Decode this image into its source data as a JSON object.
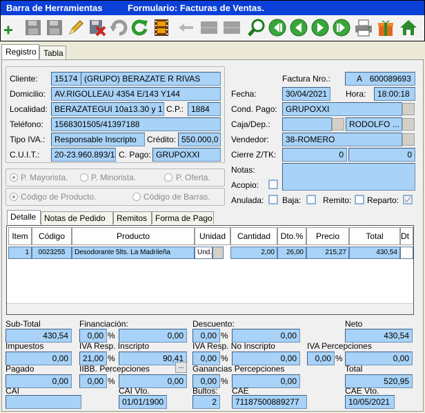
{
  "window": {
    "app_title": "Barra de Herramientas",
    "form_title": "Formulario: Facturas de Ventas."
  },
  "toolbar": {
    "buttons": [
      "add-icon",
      "save-icon",
      "save-disabled-icon",
      "edit-icon",
      "delete-icon",
      "undo-icon",
      "refresh-icon",
      "film-icon",
      "back-icon",
      "disabled-icon",
      "disabled-icon",
      "search-icon",
      "first-icon",
      "previous-icon",
      "next-icon",
      "last-icon",
      "print-icon",
      "gift-icon",
      "home-icon"
    ]
  },
  "tabs": {
    "registro": "Registro",
    "tabla": "Tabla"
  },
  "cliente": {
    "cliente_label": "Cliente:",
    "cliente_code": "15174",
    "cliente_name": "(GRUPO) BERAZATE R RIVAS",
    "domicilio_label": "Domicilio:",
    "domicilio": "AV.RIGOLLEAU 4354 E/143 Y144",
    "localidad_label": "Localidad:",
    "localidad": "BERAZATEGUI 10a13.30 y 1",
    "cp_label": "C.P.:",
    "cp": "1884",
    "telefono_label": "Teléfono:",
    "telefono": "1568301505/41397188",
    "tipo_iva_label": "Tipo IVA.:",
    "tipo_iva": "Responsable Inscripto",
    "credito_label": "Crédito:",
    "credito": "550.000,0",
    "cuit_label": "C.U.I.T.:",
    "cuit": "20-23.960.893/1",
    "cpago_label": "C. Pago:",
    "cpago": "GRUPOXXI"
  },
  "factura": {
    "nro_label": "Factura Nro.:",
    "nro_letter": "A",
    "nro": "600089693",
    "fecha_label": "Fecha:",
    "fecha": "30/04/2021",
    "hora_label": "Hora:",
    "hora": "18:00:18",
    "cond_pago_label": "Cond. Pago:",
    "cond_pago": "GRUPOXXI",
    "caja_label": "Caja/Dep.:",
    "caja": "",
    "deposito": "RODOLFO ...",
    "vendedor_label": "Vendedor:",
    "vendedor": "38-ROMERO",
    "cierre_label": "Cierre Z/TK:",
    "cierre1": "0",
    "cierre2": "0",
    "notas_label": "Notas:",
    "acopio_label": "Acopio:",
    "anulada_label": "Anulada:",
    "baja_label": "Baja:",
    "remito_label": "Remito:",
    "reparto_label": "Reparto:"
  },
  "precio_opts": {
    "mayorista": "P. Mayorista.",
    "minorista": "P. Minorista.",
    "oferta": "P. Oferta."
  },
  "codigo_opts": {
    "producto": "Código de Producto.",
    "barras": "Código de Barras."
  },
  "subtabs": [
    "Detalle",
    "Notas de Pedido",
    "Remitos",
    "Forma de Pago"
  ],
  "grid": {
    "headers": [
      "Item",
      "Código",
      "Producto",
      "Unidad",
      "Cantidad",
      "Dto.%",
      "Precio",
      "Total",
      "Dt"
    ],
    "rows": [
      {
        "item": "1",
        "codigo": "0023255",
        "producto": "Desodorante 5lts. La Madrileña",
        "unidad": "Und.",
        "cantidad": "2,00",
        "dto": "26,00",
        "precio": "215,27",
        "total": "430,54"
      }
    ]
  },
  "totales": {
    "subtotal_label": "Sub-Total",
    "subtotal": "430,54",
    "financiacion_label": "Financiación:",
    "financiacion_pct": "0,00",
    "financiacion": "0,00",
    "descuento_label": "Descuento:",
    "descuento_pct": "0,00",
    "descuento": "0,00",
    "neto_label": "Neto",
    "neto": "430,54",
    "impuestos_label": "Impuestos",
    "impuestos": "0,00",
    "iva_ri_label": "IVA Resp. Inscripto",
    "iva_ri_pct": "21,00",
    "iva_ri": "90,41",
    "iva_rni_label": "IVA Resp. No Inscripto",
    "iva_rni_pct": "0,00",
    "iva_rni": "0,00",
    "iva_perc_label": "IVA Percepciones",
    "iva_perc_pct": "0,00",
    "iva_perc": "0,00",
    "pagado_label": "Pagado",
    "pagado": "0,00",
    "iibb_label": "IIBB. Percepciones",
    "iibb_pct": "0,00",
    "iibb": "0,00",
    "iibb_btn": "...",
    "ganancias_label": "Ganancias Percepciones",
    "ganancias_pct": "0,00",
    "ganancias": "0,00",
    "total_label": "Total",
    "total": "520,95",
    "cai_label": "CAI",
    "cai": "",
    "cai_vto_label": "CAI Vto.",
    "cai_vto": "01/01/1900",
    "bultos_label": "Bultos:",
    "bultos": "2",
    "cae_label": "CAE",
    "cae": "71187500889277",
    "cae_vto_label": "CAE Vto.",
    "cae_vto": "10/05/2021",
    "pct_sign": "%"
  }
}
